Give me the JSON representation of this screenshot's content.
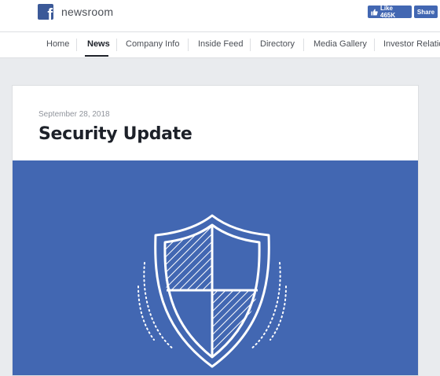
{
  "header": {
    "logo_letter": "f",
    "brand": "newsroom",
    "like_label": "Like 465K",
    "share_label": "Share"
  },
  "nav": {
    "items": [
      {
        "label": "Home"
      },
      {
        "label": "News"
      },
      {
        "label": "Company Info"
      },
      {
        "label": "Inside Feed"
      },
      {
        "label": "Directory"
      },
      {
        "label": "Media Gallery"
      },
      {
        "label": "Investor Relatio"
      }
    ],
    "active": "News"
  },
  "article": {
    "date": "September 28, 2018",
    "title": "Security Update",
    "hero_icon": "shield-icon"
  },
  "colors": {
    "brand_blue": "#3b5998",
    "hero_blue": "#4267b2",
    "page_bg": "#e9ebee"
  }
}
